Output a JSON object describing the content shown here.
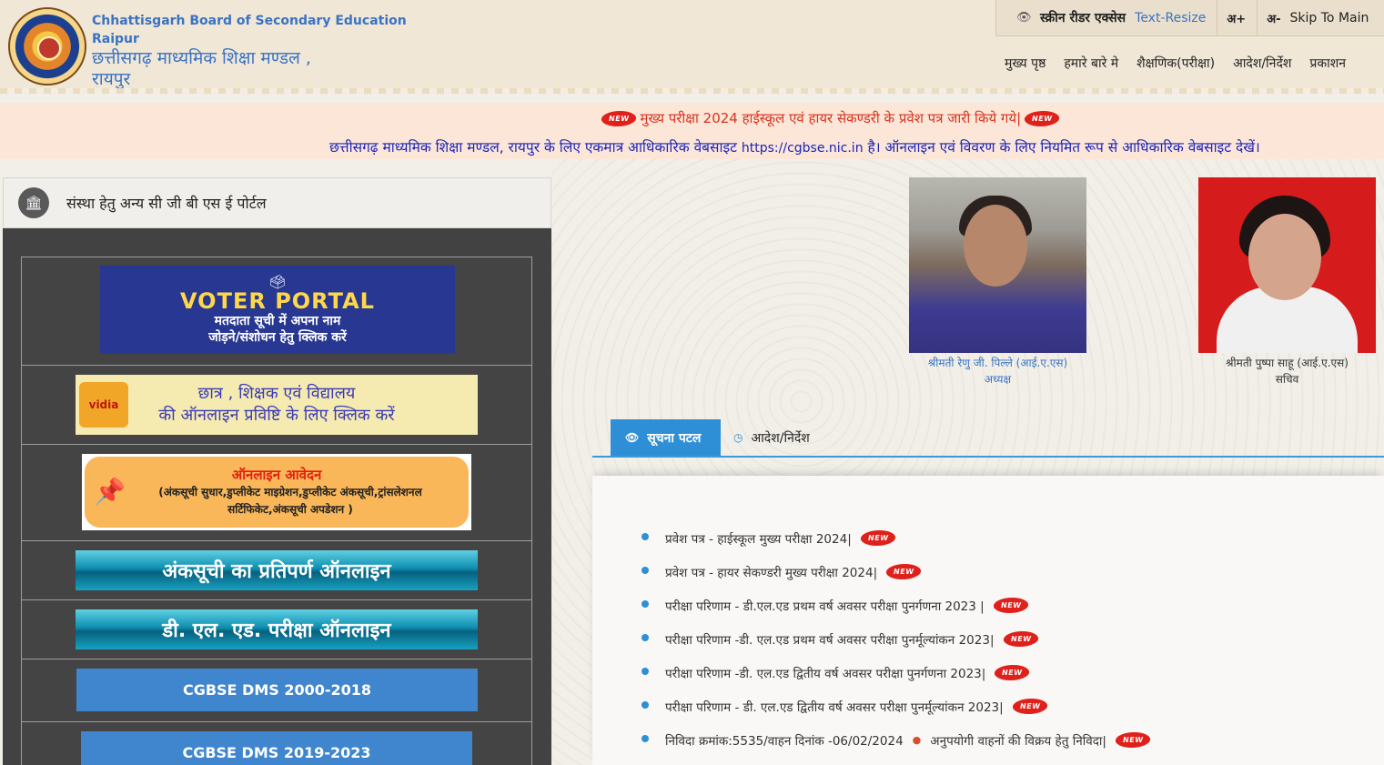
{
  "header": {
    "title_en_line1": "Chhattisgarh Board of Secondary Education",
    "title_en_line2": "Raipur",
    "title_hi_line1": "छत्तीसगढ़ माध्यमिक शिक्षा मण्डल ,",
    "title_hi_line2": "रायपुर",
    "topbar": {
      "screen_reader": "स्क्रीन रीडर एक्सेस",
      "text_resize": "Text-Resize",
      "increase": "अ+",
      "decrease": "अ-",
      "skip": "Skip To Main"
    },
    "nav": [
      "मुख्य पृष्ठ",
      "हमारे बारे मे",
      "शैक्षणिक(परीक्षा)",
      "आदेश/निर्देश",
      "प्रकाशन"
    ]
  },
  "marquee": {
    "line1": "मुख्य परीक्षा 2024 हाईस्कूल एवं हायर सेकण्डरी के प्रवेश पत्र जारी किये गये|",
    "line2_pre": "छत्तीसगढ़ माध्यमिक शिक्षा मण्डल, रायपुर के लिए एकमात्र आधिकारिक वेबसाइट",
    "line2_url": "https://cgbse.nic.in",
    "line2_post": "है। ऑनलाइन एवं विवरण के लिए नियमित रूप से आधिकारिक वेबसाइट देखें।",
    "new_badge": "NEW"
  },
  "left_panel": {
    "heading": "संस्था हेतु अन्य सी जी बी एस ई पोर्टल",
    "voter": {
      "title": "VOTER PORTAL",
      "line1": "मतदाता सूची में अपना नाम",
      "line2": "जोड़ने/संशोधन हेतु क्लिक करें"
    },
    "vidya": {
      "logo": "vidia",
      "line1": "छात्र , शिक्षक एवं विद्यालय",
      "line2": "की ऑनलाइन प्रविष्टि के लिए क्लिक करें"
    },
    "online": {
      "title": "ऑनलाइन आवेदन",
      "line1": "(अंकसूची  सुधार,डुप्लीकेट माइग्रेशन,डुप्लीकेट अंकसूची,ट्रांसलेशनल",
      "line2": "सर्टिफिकेट,अंकसूची अपडेशन )"
    },
    "ank": "अंकसूची का प्रतिपर्ण ऑनलाइन",
    "del": "डी. एल. एड. परीक्षा ऑनलाइन",
    "dms1": "CGBSE DMS 2000-2018",
    "dms2": "CGBSE DMS 2019-2023"
  },
  "officials": [
    {
      "name": "श्रीमती रेणु जी. पिल्ले (आई.ए.एस)",
      "role": "अध्यक्ष"
    },
    {
      "name": "श्रीमती पुष्पा साहू (आई.ए.एस)",
      "role": "सचिव"
    }
  ],
  "tabs": [
    {
      "label": "सूचना पटल",
      "active": true
    },
    {
      "label": "आदेश/निर्देश",
      "active": false
    }
  ],
  "notices": [
    "प्रवेश पत्र - हाईस्कूल मुख्य परीक्षा 2024|",
    "प्रवेश पत्र - हायर सेकण्डरी मुख्य परीक्षा 2024|",
    "परीक्षा परिणाम - डी.एल.एड प्रथम वर्ष अवसर परीक्षा पुनर्गणना 2023 |",
    "परीक्षा परिणाम -डी. एल.एड प्रथम वर्ष अवसर परीक्षा पुनर्मूल्यांकन 2023|",
    "परीक्षा परिणाम -डी. एल.एड द्वितीय वर्ष अवसर परीक्षा पुनर्गणना 2023|",
    "परीक्षा परिणाम - डी. एल.एड द्वितीय वर्ष अवसर परीक्षा पुनर्मूल्यांकन 2023|"
  ],
  "notice_tender": {
    "part1": "निविदा क्रमांक:5535/वाहन दिनांक -06/02/2024",
    "part2": "अनुपयोगी वाहनों की विक्रय हेतु निविदा|"
  }
}
